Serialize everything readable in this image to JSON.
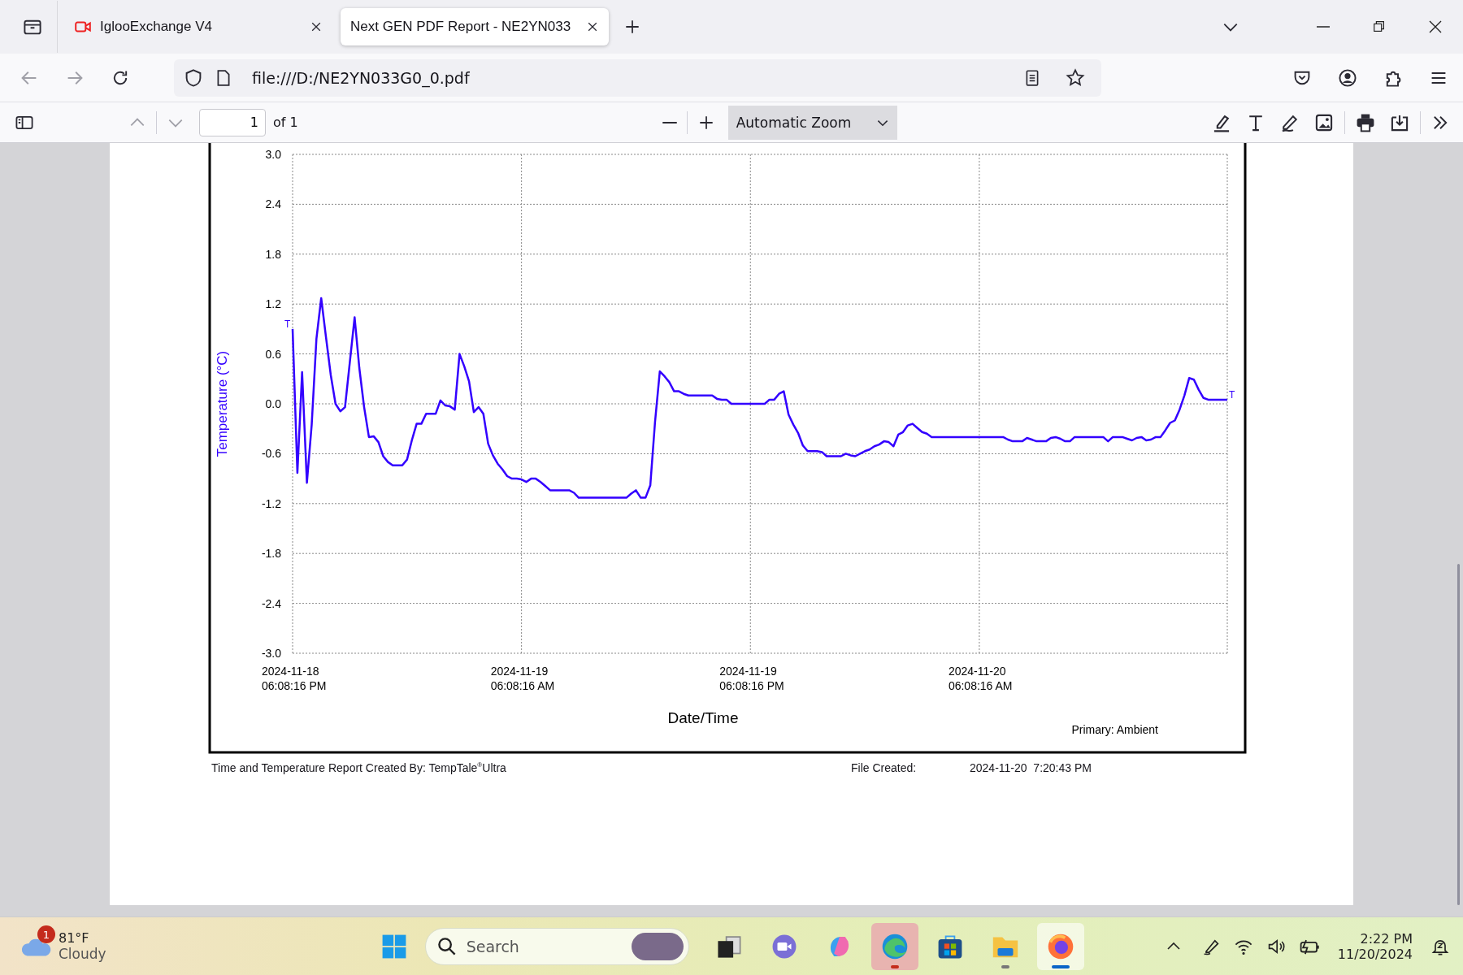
{
  "browser": {
    "tabs": [
      {
        "title": "IglooExchange V4",
        "selected": false
      },
      {
        "title": "Next GEN PDF Report - NE2YN033",
        "selected": true
      }
    ],
    "address": "file:///D:/NE2YN033G0_0.pdf"
  },
  "pdf_toolbar": {
    "page": "1",
    "page_count": "of 1",
    "zoom": "Automatic Zoom"
  },
  "report": {
    "chart_data": {
      "type": "line",
      "xlabel": "Date/Time",
      "ylabel": "Temperature (°C)",
      "ylim": [
        -3,
        3
      ],
      "categories": [
        "2024-11-18 06:08:16 PM",
        null,
        null,
        null,
        null,
        null,
        null,
        null,
        null,
        null,
        null,
        null,
        null,
        null,
        null,
        null,
        null,
        null,
        null,
        null,
        null,
        null,
        null,
        null,
        null,
        null,
        null,
        null,
        null,
        null,
        null,
        null,
        null,
        null,
        null,
        null,
        null,
        null,
        null,
        null,
        null,
        null,
        null,
        null,
        null,
        null,
        null,
        null,
        "2024-11-19 06:08:16 AM",
        null,
        null,
        null,
        null,
        null,
        null,
        null,
        null,
        null,
        null,
        null,
        null,
        null,
        null,
        null,
        null,
        null,
        null,
        null,
        null,
        null,
        null,
        null,
        null,
        null,
        null,
        null,
        null,
        null,
        null,
        null,
        null,
        null,
        null,
        null,
        null,
        null,
        null,
        null,
        null,
        null,
        null,
        null,
        null,
        null,
        null,
        null,
        "2024-11-19 06:08:16 PM",
        null,
        null,
        null,
        null,
        null,
        null,
        null,
        null,
        null,
        null,
        null,
        null,
        null,
        null,
        null,
        null,
        null,
        null,
        null,
        null,
        null,
        null,
        null,
        null,
        null,
        null,
        null,
        null,
        null,
        null,
        null,
        null,
        null,
        null,
        null,
        null,
        null,
        null,
        null,
        null,
        null,
        null,
        null,
        null,
        null,
        null,
        null,
        "2024-11-20 06:08:16 AM",
        null,
        null,
        null,
        null,
        null,
        null,
        null,
        null,
        null,
        null,
        null,
        null,
        null,
        null,
        null,
        null,
        null,
        null,
        null,
        null,
        null,
        null,
        null,
        null,
        null,
        null,
        null,
        null,
        null,
        null,
        null,
        null,
        null,
        null,
        null,
        null,
        null,
        null,
        null,
        null,
        null,
        null,
        null,
        null,
        null,
        null,
        null,
        null,
        null,
        null,
        null,
        null
      ],
      "yticks": [
        {
          "value": 3,
          "label": "3.0"
        },
        {
          "value": 2.4,
          "label": "2.4"
        },
        {
          "value": 1.8,
          "label": "1.8"
        },
        {
          "value": 1.2,
          "label": "1.2"
        },
        {
          "value": 0.6,
          "label": "0.6"
        },
        {
          "value": 0,
          "label": "0.0"
        },
        {
          "value": -0.6,
          "label": "-0.6"
        },
        {
          "value": -1.2,
          "label": "-1.2"
        },
        {
          "value": -1.8,
          "label": "-1.8"
        },
        {
          "value": -2.4,
          "label": "-2.4"
        },
        {
          "value": -3,
          "label": "-3.0"
        }
      ],
      "series": [
        {
          "name": "Primary: Ambient",
          "color": "#3300ff",
          "values": [
            0.9,
            -0.83,
            0.38,
            -0.95,
            -0.25,
            0.78,
            1.27,
            0.8,
            0.35,
            0,
            -0.09,
            -0.04,
            0.5,
            1.04,
            0.43,
            -0.04,
            -0.4,
            -0.39,
            -0.46,
            -0.63,
            -0.7,
            -0.74,
            -0.74,
            -0.74,
            -0.67,
            -0.44,
            -0.24,
            -0.24,
            -0.12,
            -0.12,
            -0.12,
            0.04,
            -0.02,
            -0.03,
            -0.07,
            0.6,
            0.45,
            0.27,
            -0.1,
            -0.04,
            -0.12,
            -0.48,
            -0.62,
            -0.72,
            -0.79,
            -0.87,
            -0.9,
            -0.9,
            -0.91,
            -0.94,
            -0.9,
            -0.9,
            -0.94,
            -0.99,
            -1.04,
            -1.04,
            -1.04,
            -1.04,
            -1.04,
            -1.07,
            -1.13,
            -1.13,
            -1.13,
            -1.13,
            -1.13,
            -1.13,
            -1.13,
            -1.13,
            -1.13,
            -1.13,
            -1.13,
            -1.08,
            -1.04,
            -1.13,
            -1.13,
            -0.98,
            -0.22,
            0.39,
            0.33,
            0.26,
            0.15,
            0.15,
            0.12,
            0.1,
            0.1,
            0.1,
            0.1,
            0.1,
            0.1,
            0.06,
            0.05,
            0.05,
            0,
            0,
            0,
            0,
            0,
            0,
            0,
            0,
            0.05,
            0.05,
            0.12,
            0.15,
            -0.13,
            -0.25,
            -0.35,
            -0.5,
            -0.57,
            -0.57,
            -0.57,
            -0.58,
            -0.63,
            -0.63,
            -0.63,
            -0.63,
            -0.6,
            -0.62,
            -0.63,
            -0.6,
            -0.57,
            -0.55,
            -0.51,
            -0.49,
            -0.45,
            -0.46,
            -0.51,
            -0.37,
            -0.34,
            -0.26,
            -0.24,
            -0.29,
            -0.34,
            -0.36,
            -0.4,
            -0.4,
            -0.4,
            -0.4,
            -0.4,
            -0.4,
            -0.4,
            -0.4,
            -0.4,
            -0.4,
            -0.4,
            -0.4,
            -0.4,
            -0.4,
            -0.4,
            -0.4,
            -0.43,
            -0.45,
            -0.45,
            -0.45,
            -0.41,
            -0.43,
            -0.45,
            -0.45,
            -0.45,
            -0.41,
            -0.4,
            -0.42,
            -0.45,
            -0.45,
            -0.4,
            -0.4,
            -0.4,
            -0.4,
            -0.4,
            -0.4,
            -0.4,
            -0.45,
            -0.4,
            -0.4,
            -0.4,
            -0.42,
            -0.44,
            -0.41,
            -0.4,
            -0.44,
            -0.43,
            -0.4,
            -0.4,
            -0.32,
            -0.23,
            -0.2,
            -0.07,
            0.1,
            0.31,
            0.29,
            0.17,
            0.07,
            0.05,
            0.05,
            0.05,
            0.05,
            0.05
          ]
        }
      ],
      "grid": true,
      "annotations": [
        "T",
        "T"
      ]
    },
    "footer": {
      "created_by": "Time and Temperature Report Created By:  TempTale$^{®}$Ultra",
      "file_created_label": "File Created:",
      "file_created": "2024-11-20  7:20:43 PM"
    }
  },
  "taskbar": {
    "weather": {
      "temperature": "81°F",
      "condition": "Cloudy",
      "badge": "1"
    },
    "search": {
      "placeholder": "Search"
    },
    "apps": [
      {
        "kind": "taskview",
        "selected": false,
        "running": false,
        "flashing": false
      },
      {
        "kind": "chat",
        "selected": false,
        "running": false,
        "flashing": false
      },
      {
        "kind": "swirl",
        "selected": false,
        "running": false,
        "flashing": false
      },
      {
        "kind": "edge",
        "selected": false,
        "running": true,
        "flashing": true
      },
      {
        "kind": "store",
        "selected": false,
        "running": false,
        "flashing": false
      },
      {
        "kind": "folder",
        "selected": false,
        "running": true,
        "flashing": false
      },
      {
        "kind": "firefox",
        "selected": true,
        "running": true,
        "flashing": false
      }
    ],
    "time": "2:22 PM",
    "date": "11/20/2024"
  }
}
